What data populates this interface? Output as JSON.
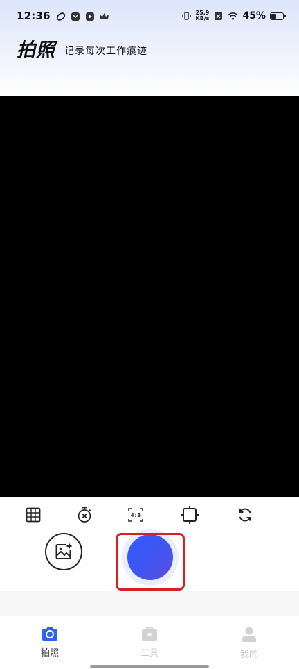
{
  "status_bar": {
    "time": "12:36",
    "net_speed_value": "25.9",
    "net_speed_unit": "KB/s",
    "battery": "45%"
  },
  "header": {
    "title": "拍照",
    "subtitle": "记录每次工作痕迹"
  },
  "camera_tools": {
    "aspect_ratio": "4:3"
  },
  "tabbar": {
    "tabs": [
      {
        "label": "拍照",
        "icon": "camera-icon",
        "active": true
      },
      {
        "label": "工具",
        "icon": "toolbox-icon",
        "active": false
      },
      {
        "label": "我的",
        "icon": "person-icon",
        "active": false
      }
    ]
  },
  "colors": {
    "accent": "#2f5cff",
    "highlight": "#d81f26",
    "inactive": "#c8c8cc"
  }
}
